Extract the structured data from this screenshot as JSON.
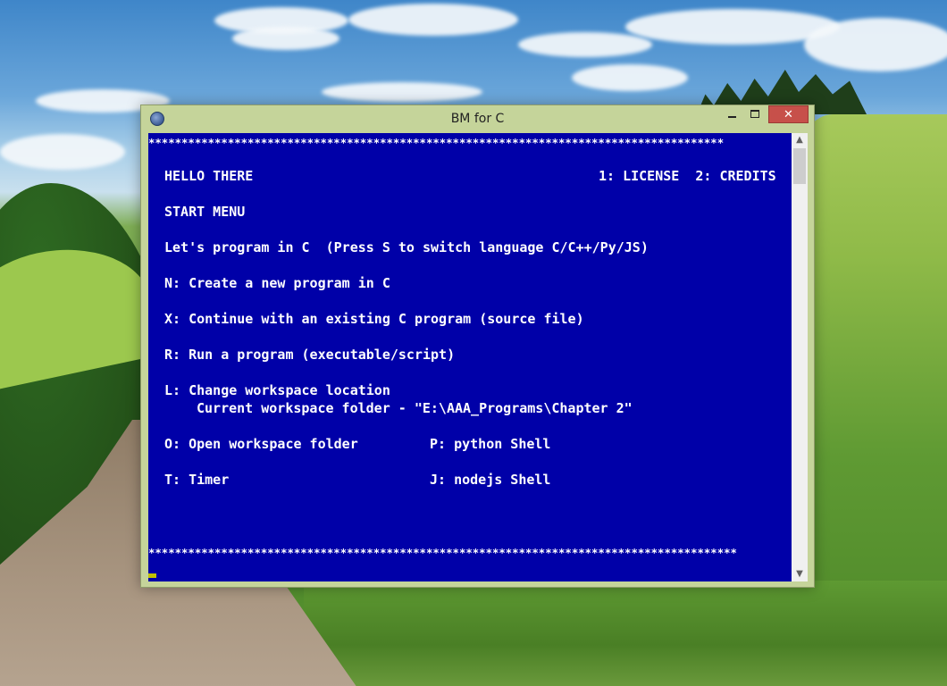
{
  "window": {
    "title": "BM for C",
    "icon": "app-icon",
    "controls": {
      "minimize_icon": "minimize-icon",
      "maximize_icon": "maximize-icon",
      "close_label": "✕"
    }
  },
  "console": {
    "border_top": "***************************************************************************************",
    "border_bottom": "*****************************************************************************************",
    "greeting": "HELLO THERE",
    "header_right": "1: LICENSE  2: CREDITS",
    "menu_title": "START MENU",
    "language_line": "Let's program in C  (Press S to switch language C/C++/Py/JS)",
    "option_n": "N: Create a new program in C",
    "option_x": "X: Continue with an existing C program (source file)",
    "option_r": "R: Run a program (executable/script)",
    "option_l": "L: Change workspace location",
    "workspace_line": "Current workspace folder - \"E:\\AAA_Programs\\Chapter 2\"",
    "option_o": "O: Open workspace folder",
    "option_p": "P: python Shell",
    "option_t": "T: Timer",
    "option_j": "J: nodejs Shell",
    "colors": {
      "background": "#0000a8",
      "text": "#ffffff",
      "cursor": "#c0c000"
    }
  },
  "scrollbar": {
    "up_icon": "scroll-up-icon",
    "down_icon": "scroll-down-icon"
  }
}
